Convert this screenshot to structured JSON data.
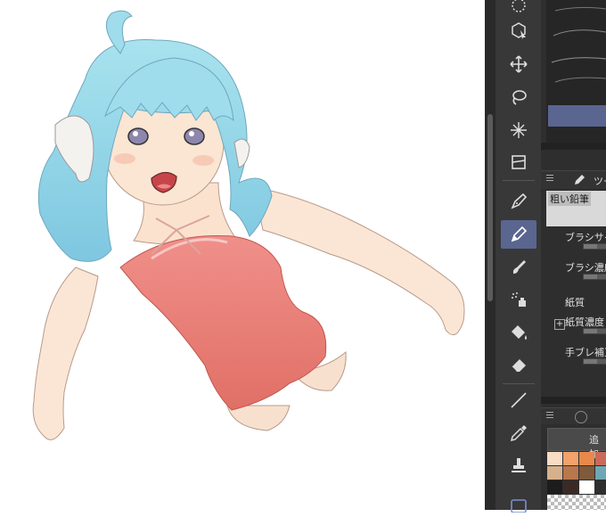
{
  "icons": {
    "toolbar": [
      "lasso-dot-icon",
      "object-select-icon",
      "move-icon",
      "lasso-icon",
      "magic-wand-icon",
      "transform-icon",
      "pen-icon",
      "pencil-icon",
      "brush-icon",
      "airbrush-icon",
      "fill-icon",
      "eraser-icon",
      "line-icon",
      "eyedropper-icon",
      "stamp-icon",
      "frame-icon"
    ],
    "selected_tool": "pencil-icon"
  },
  "sub_tool_panel": {
    "tab_label": "ツー",
    "selected_brush": "粗い鉛筆"
  },
  "tool_property": {
    "brush_size_label": "ブラシサイ",
    "brush_density_label": "ブラシ濃度",
    "paper_label": "紙質",
    "paper_density_label": "紙質濃度",
    "stabilization_label": "手ブレ補正"
  },
  "color_set": {
    "add_button": "追加",
    "swatch_colors": [
      "#f9dcc4",
      "#f2a26a",
      "#e8884a",
      "#c96a5a",
      "#d7b08d",
      "#b9774c",
      "#7f5a3c",
      "#6fa7b4",
      "#1c1c1c",
      "#3b2a24",
      "#ffffff"
    ]
  },
  "colors": {
    "accent": "#5a6590",
    "panel_bg": "#2e2e2e",
    "toolbar_bg": "#383838"
  }
}
